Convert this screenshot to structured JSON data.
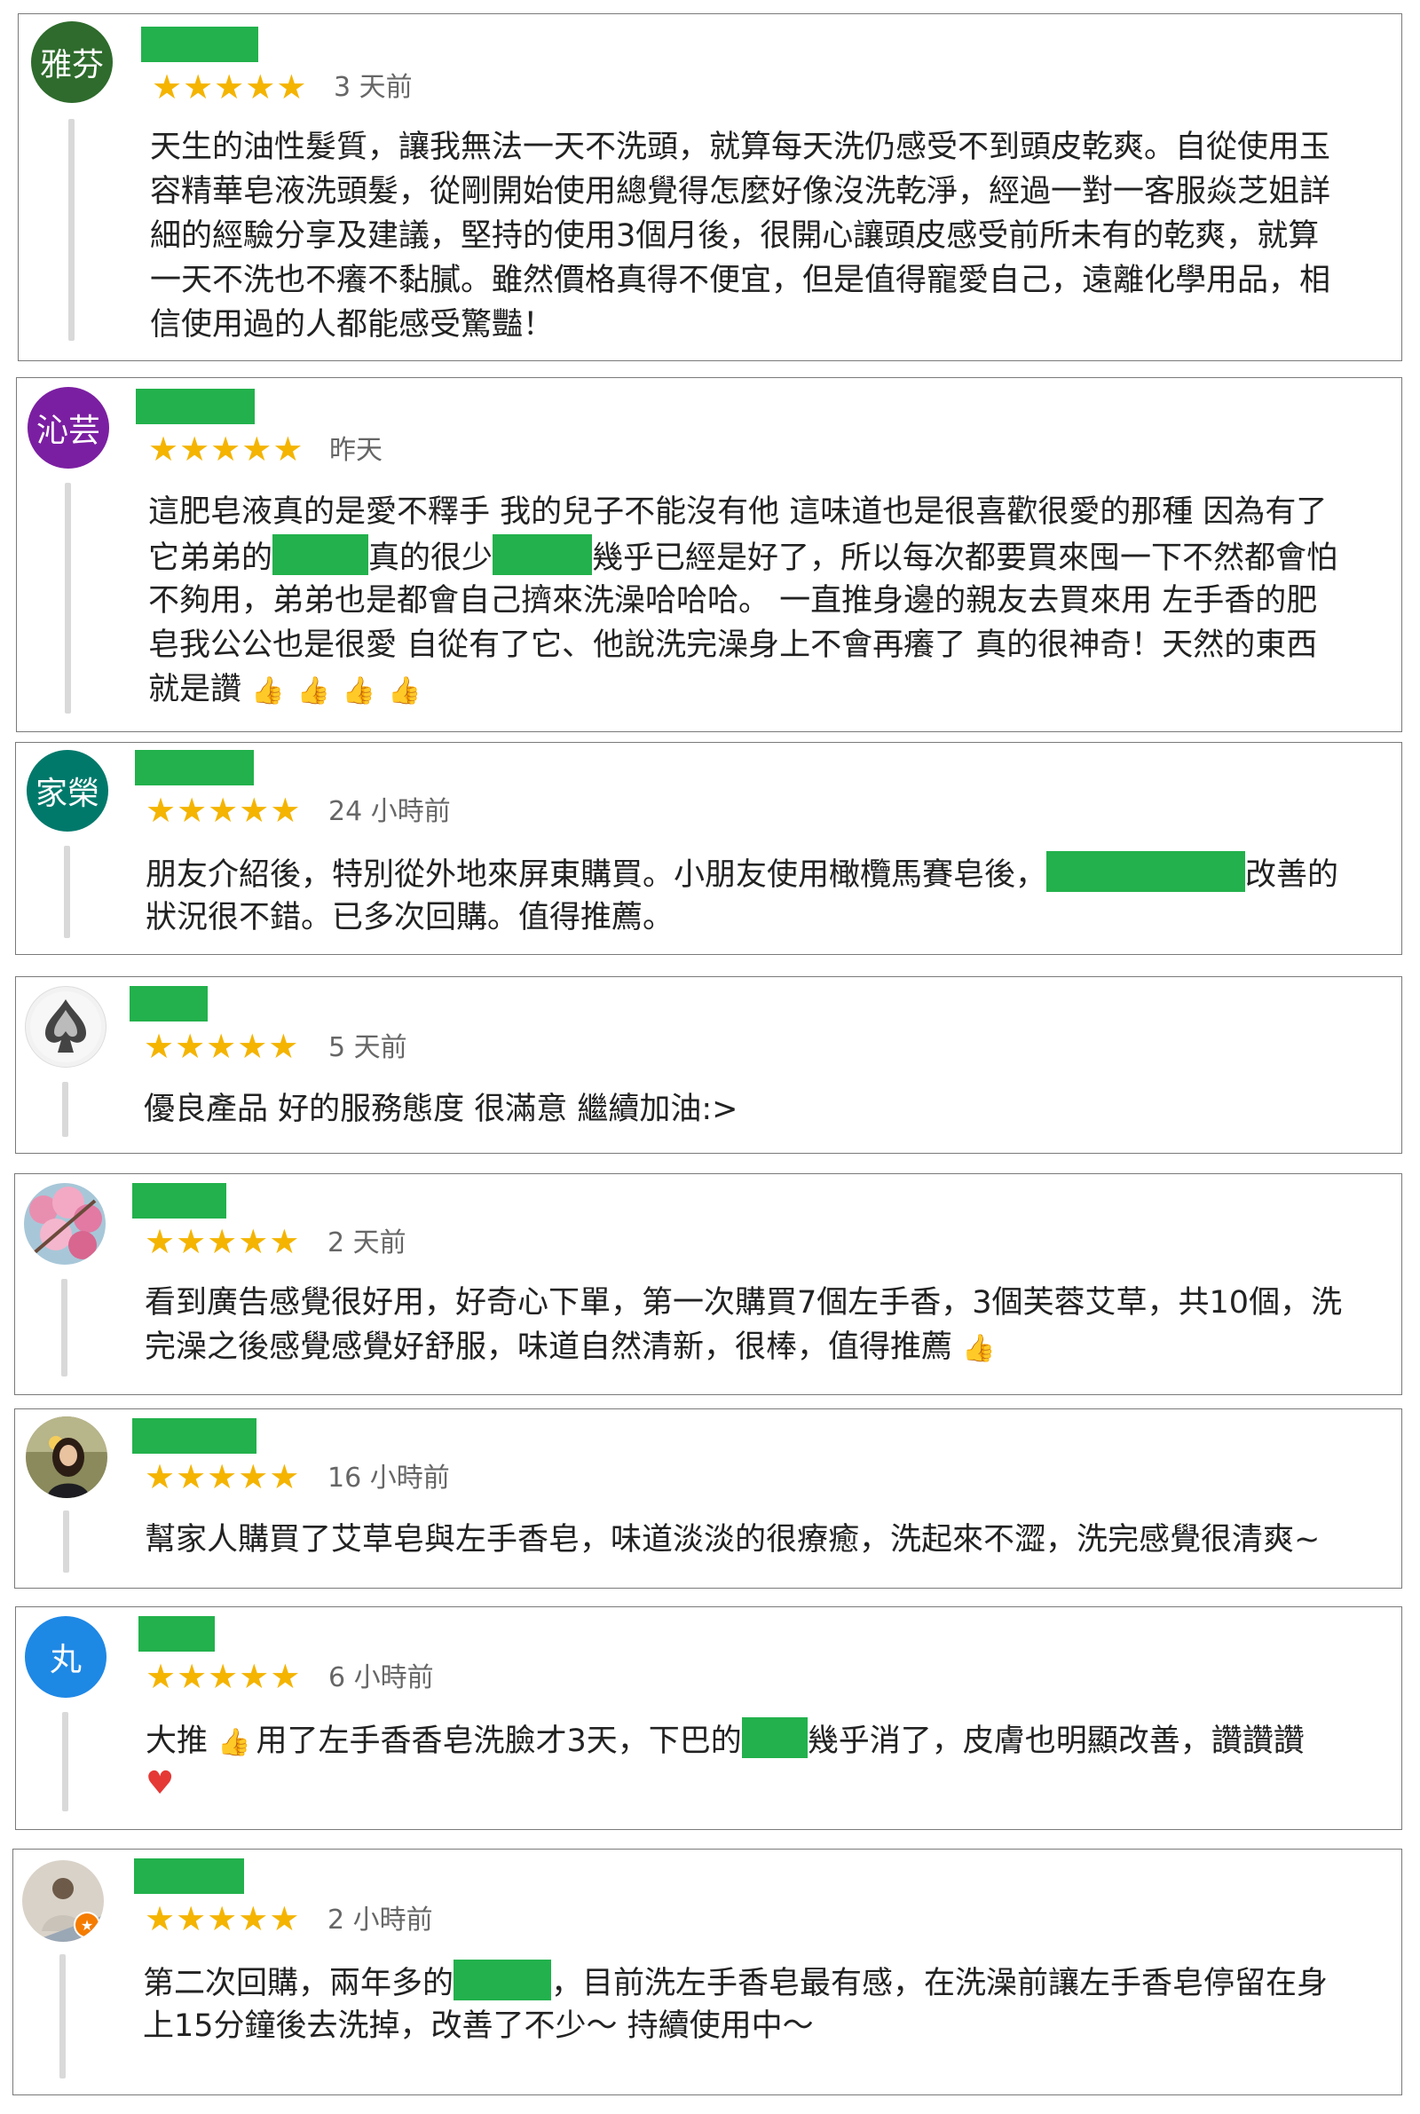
{
  "reviews": [
    {
      "avatar_text": "雅芬",
      "avatar_color": "#2e6b2c",
      "rating": 5,
      "time": "3 天前",
      "lines": [
        "天生的油性髮質，讓我無法一天不洗頭，就算每天洗仍感受不到頭皮乾爽。自從使用玉",
        "容精華皂液洗頭髮，從剛開始使用總覺得怎麼好像沒洗乾淨，經過一對一客服焱芝姐詳",
        "細的經驗分享及建議，堅持的使用3個月後，很開心讓頭皮感受前所未有的乾爽，就算",
        "一天不洗也不癢不黏膩。雖然價格真得不便宜，但是值得寵愛自己，遠離化學用品，相",
        "信使用過的人都能感受驚豔！"
      ]
    },
    {
      "avatar_text": "沁芸",
      "avatar_color": "#7b1fa2",
      "rating": 5,
      "time": "昨天",
      "line1": "這肥皂液真的是愛不釋手 我的兒子不能沒有他 這味道也是很喜歡很愛的那種 因為有了",
      "line2_a": "它弟弟的",
      "line2_b": "真的很少",
      "line2_c": "幾乎已經是好了，所以每次都要買來囤一下不然都會怕",
      "line3": "不夠用，弟弟也是都會自己擠來洗澡哈哈哈。 一直推身邊的親友去買來用 左手香的肥",
      "line4": "皂我公公也是很愛 自從有了它、他說洗完澡身上不會再癢了 真的很神奇！天然的東西",
      "line5": "就是讚"
    },
    {
      "avatar_text": "家榮",
      "avatar_color": "#00796b",
      "rating": 5,
      "time": "24 小時前",
      "line1_a": "朋友介紹後，特別從外地來屏東購買。小朋友使用橄欖馬賽皂後，",
      "line1_b": "改善的",
      "line2": "狀況很不錯。已多次回購。值得推薦。"
    },
    {
      "avatar_icon": "spade-logo-icon",
      "rating": 5,
      "time": "5 天前",
      "line1": "優良產品 好的服務態度 很滿意 繼續加油:>"
    },
    {
      "avatar_icon": "flower-photo-icon",
      "rating": 5,
      "time": "2 天前",
      "line1": "看到廣告感覺很好用，好奇心下單，第一次購買7個左手香，3個芙蓉艾草，共10個，洗",
      "line2": "完澡之後感覺感覺好舒服，味道自然清新，很棒，值得推薦"
    },
    {
      "avatar_icon": "person-photo-icon",
      "rating": 5,
      "time": "16 小時前",
      "line1": "幫家人購買了艾草皂與左手香皂，味道淡淡的很療癒，洗起來不澀，洗完感覺很清爽~"
    },
    {
      "avatar_text": "丸",
      "avatar_color": "#1e88e5",
      "rating": 5,
      "time": "6 小時前",
      "line1_a": "大推",
      "line1_b": "用了左手香香皂洗臉才3天，下巴的",
      "line1_c": "幾乎消了，皮膚也明顯改善，讚讚讚"
    },
    {
      "avatar_icon": "person-guide-photo-icon",
      "rating": 5,
      "time": "2 小時前",
      "line1_a": "第二次回購，兩年多的",
      "line1_b": "，目前洗左手香皂最有感，在洗澡前讓左手香皂停留在身",
      "line2": "上15分鐘後去洗掉，改善了不少～ 持續使用中～"
    }
  ],
  "star_glyph": "★",
  "thumb_glyph": "👍",
  "heart_glyph": "♥",
  "colors": {
    "star": "#f4b400",
    "redaction": "#22b14c",
    "border": "#7a7a7a"
  }
}
